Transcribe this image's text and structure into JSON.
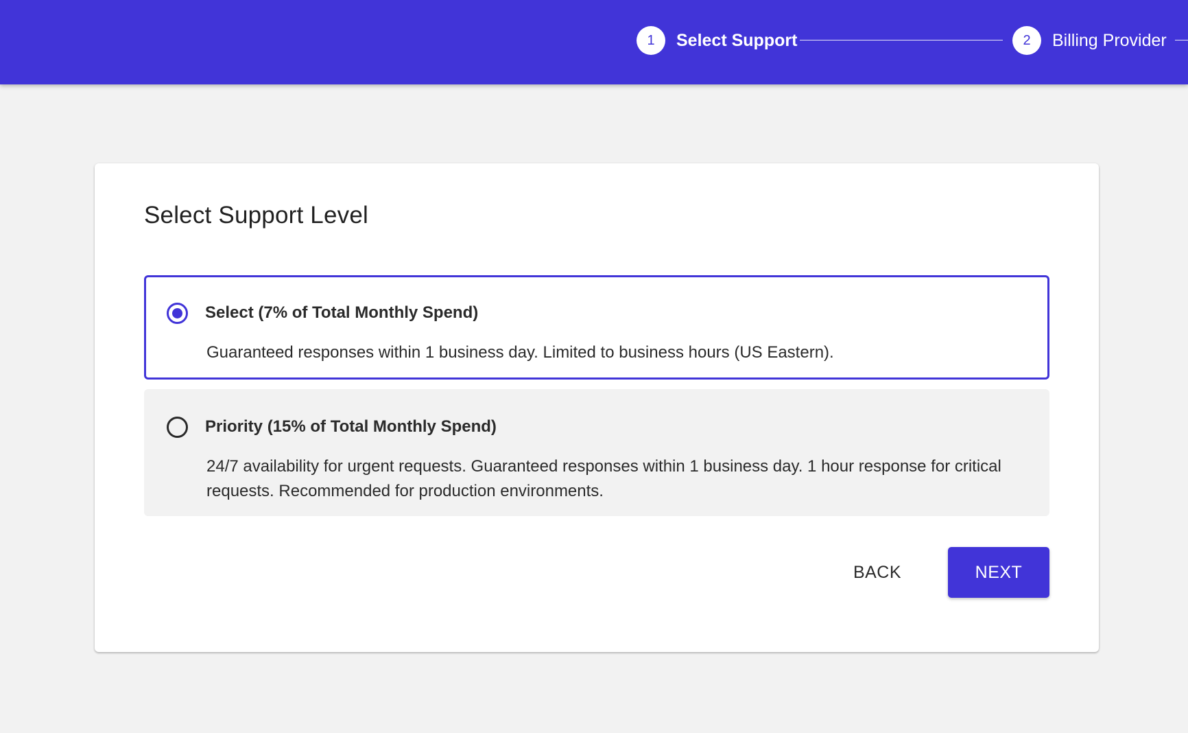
{
  "stepper": {
    "steps": [
      {
        "number": "1",
        "label": "Select Support",
        "active": true
      },
      {
        "number": "2",
        "label": "Billing Provider",
        "active": false
      }
    ]
  },
  "card": {
    "title": "Select Support Level",
    "options": [
      {
        "title": "Select (7% of Total Monthly Spend)",
        "description": "Guaranteed responses within 1 business day. Limited to business hours (US Eastern).",
        "selected": true
      },
      {
        "title": "Priority (15% of Total Monthly Spend)",
        "description": "24/7 availability for urgent requests. Guaranteed responses within 1 business day. 1 hour response for critical requests. Recommended for production environments.",
        "selected": false
      }
    ],
    "actions": {
      "back_label": "BACK",
      "next_label": "NEXT"
    }
  },
  "colors": {
    "primary": "#4134d8",
    "background": "#f2f2f2",
    "surface": "#ffffff",
    "text": "#2a2a2a"
  }
}
